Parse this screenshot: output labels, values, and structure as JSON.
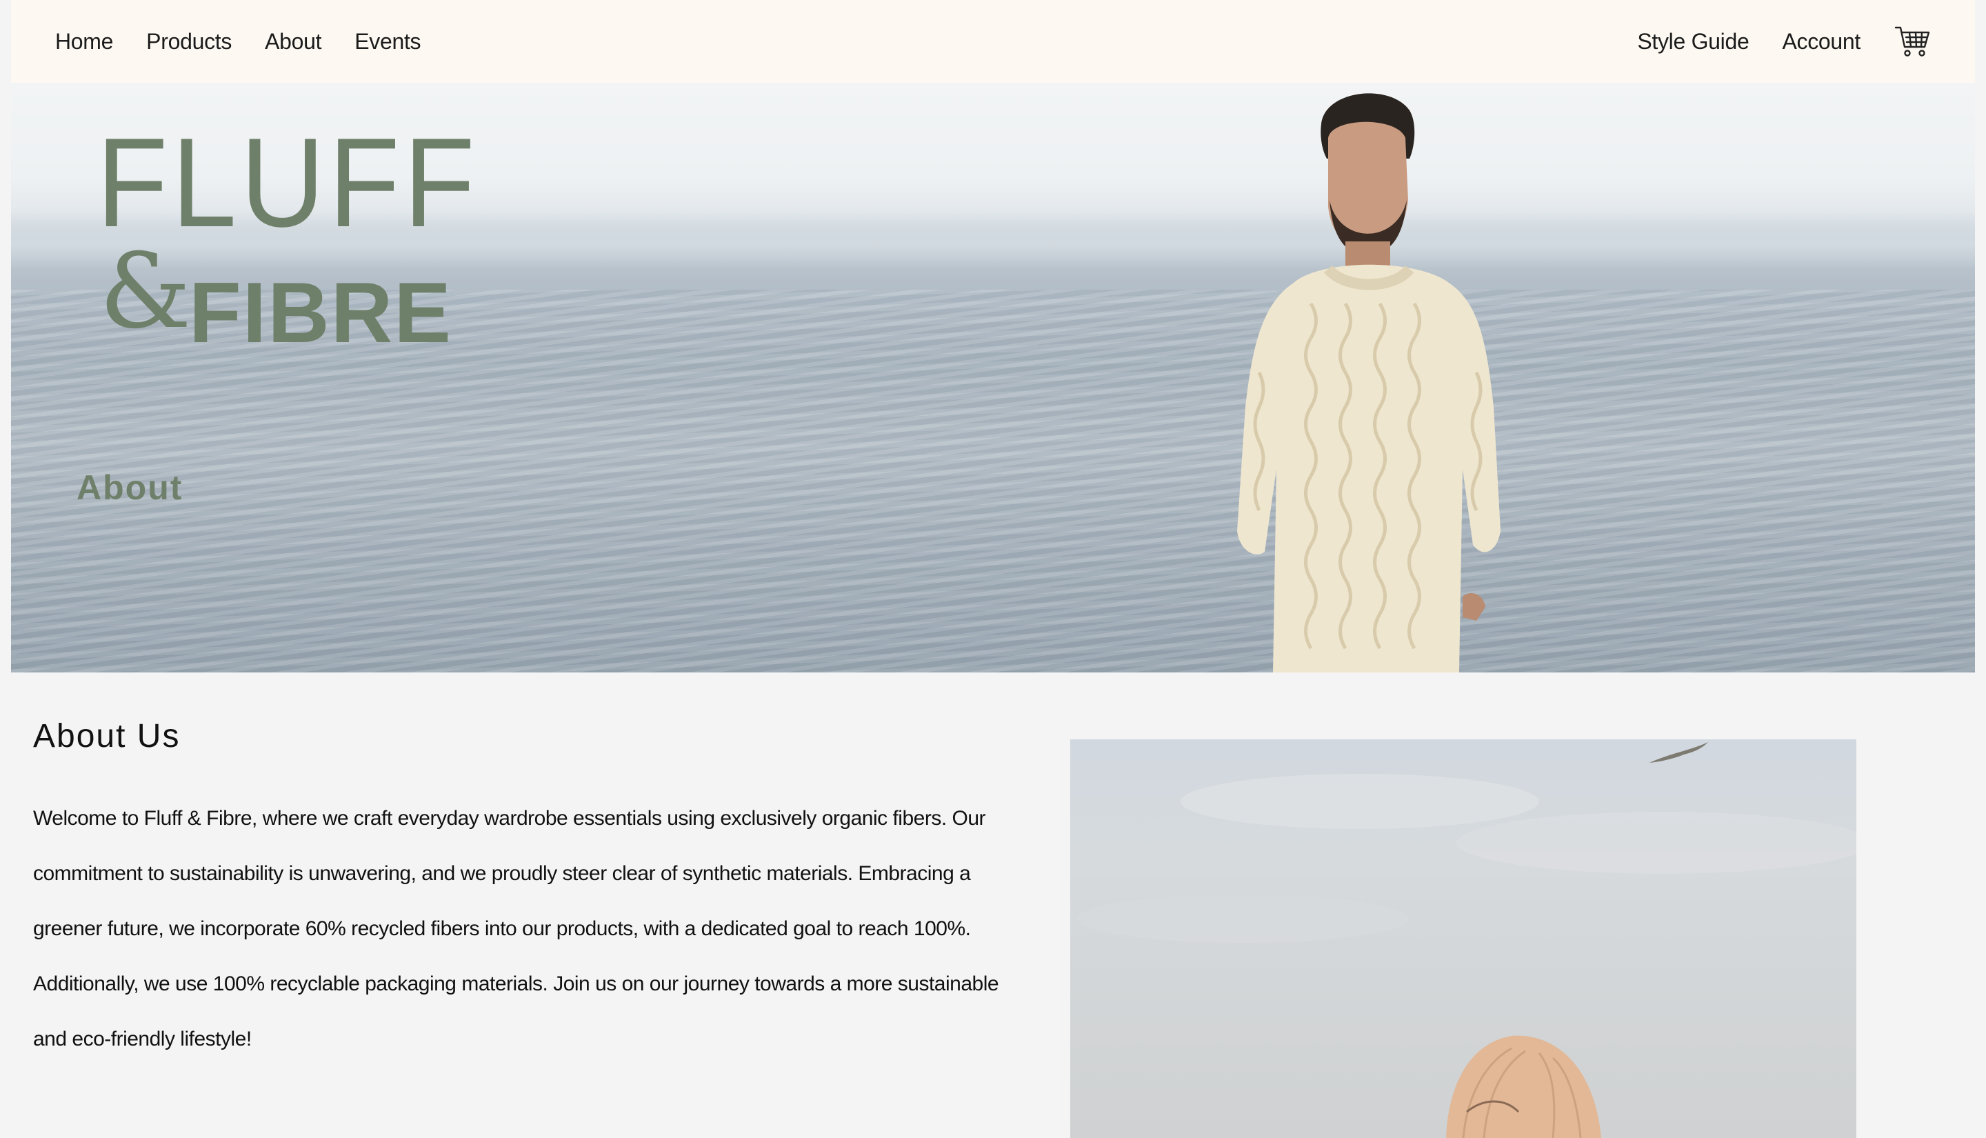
{
  "nav": {
    "left_links": [
      "Home",
      "Products",
      "About",
      "Events"
    ],
    "right_links": [
      "Style Guide",
      "Account"
    ],
    "cart_icon": "shopping-cart-icon"
  },
  "hero": {
    "logo_line1": "FLUFF",
    "logo_ampersand": "&",
    "logo_line2": "FIBRE",
    "heading": "About"
  },
  "about": {
    "title": "About Us",
    "body": "Welcome to Fluff & Fibre, where we craft everyday wardrobe essentials using exclusively organic fibers. Our commitment to sustainability is unwavering, and we proudly steer clear of synthetic materials. Embracing a greener future, we incorporate 60% recycled fibers into our products, with a dedicated goal to reach 100%. Additionally, we use 100% recyclable packaging materials. Join us on our journey towards a more sustainable and eco-friendly lifestyle!"
  },
  "colors": {
    "nav_bg": "#fdf9f2",
    "brand_green": "#6f806a",
    "page_bg": "#f4f4f4"
  }
}
